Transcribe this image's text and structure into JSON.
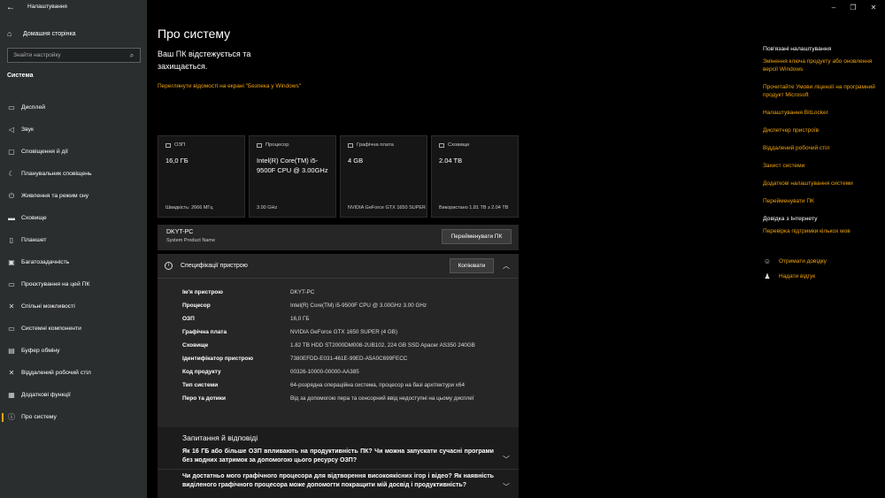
{
  "app": {
    "title": "Налаштування",
    "back_icon": "back-arrow-icon",
    "window_controls": [
      "–",
      "❐",
      "✕"
    ]
  },
  "sidebar": {
    "home_label": "Домашня сторінка",
    "search_placeholder": "Знайти настройку",
    "section_title": "Система",
    "items": [
      {
        "label": "Дисплей",
        "icon": "display-icon",
        "glyph": "▭"
      },
      {
        "label": "Звук",
        "icon": "sound-icon",
        "glyph": "◁"
      },
      {
        "label": "Сповіщення й дії",
        "icon": "notifications-icon",
        "glyph": "▢"
      },
      {
        "label": "Планувальник сповіщень",
        "icon": "focus-assist-icon",
        "glyph": "☾"
      },
      {
        "label": "Живлення та режим сну",
        "icon": "power-icon",
        "glyph": "⏻"
      },
      {
        "label": "Сховище",
        "icon": "storage-icon",
        "glyph": "▬"
      },
      {
        "label": "Планшет",
        "icon": "tablet-icon",
        "glyph": "▯"
      },
      {
        "label": "Багатозадачність",
        "icon": "multitasking-icon",
        "glyph": "▣"
      },
      {
        "label": "Проєктування на цей ПК",
        "icon": "projecting-icon",
        "glyph": "▭"
      },
      {
        "label": "Спільні можливості",
        "icon": "shared-experiences-icon",
        "glyph": "✕"
      },
      {
        "label": "Системні компоненти",
        "icon": "components-icon",
        "glyph": "▭"
      },
      {
        "label": "Буфер обміну",
        "icon": "clipboard-icon",
        "glyph": "▤"
      },
      {
        "label": "Віддалений робочий стіл",
        "icon": "remote-desktop-icon",
        "glyph": "✕"
      },
      {
        "label": "Додаткові функції",
        "icon": "optional-features-icon",
        "glyph": "▦"
      },
      {
        "label": "Про систему",
        "icon": "about-icon",
        "glyph": "ⓘ",
        "active": true
      }
    ]
  },
  "main": {
    "title": "Про систему",
    "protect_text": "Ваш ПК відстежується та захищається.",
    "security_link": "Переглянути відомості на екрані \"Безпека у Windows\"",
    "cards": [
      {
        "title": "ОЗП",
        "icon": "ram-icon",
        "value": "16,0 ГБ",
        "foot": "Швидкість: 2666 МГц"
      },
      {
        "title": "Процесор",
        "icon": "cpu-icon",
        "value": "Intel(R) Core(TM) i5-9500F CPU @ 3.00GHz",
        "foot": "3.00 GHz"
      },
      {
        "title": "Графічна плата",
        "icon": "gpu-icon",
        "value": "4 GB",
        "foot": "NVIDIA GeForce GTX 1650 SUPER"
      },
      {
        "title": "Сховище",
        "icon": "storage-card-icon",
        "value": "2.04 TB",
        "foot": "Використано 1.81 TB з 2.04 TB"
      }
    ],
    "pc_name": "DKYT-PC",
    "pc_model": "System Product Name",
    "rename_button": "Перейменувати ПК",
    "specs": {
      "title": "Специфікації пристрою",
      "copy_button": "Копіювати",
      "rows": [
        {
          "k": "Ім'я пристрою",
          "v": "DKYT-PC"
        },
        {
          "k": "Процесор",
          "v": "Intel(R) Core(TM) i5-9500F CPU @ 3.00GHz   3.00 GHz"
        },
        {
          "k": "ОЗП",
          "v": "16,0 ГБ"
        },
        {
          "k": "Графічна плата",
          "v": "NVIDIA GeForce GTX 1650 SUPER (4 GB)"
        },
        {
          "k": "Сховище",
          "v": "1.82 TB HDD ST2000DM008-2UB102, 224 GB SSD Apacer AS350 240GB"
        },
        {
          "k": "Ідентифікатор пристрою",
          "v": "7380EFDD-E031-461E-99ED-A5A0C699FECC"
        },
        {
          "k": "Код продукту",
          "v": "00326-10000-00000-AA385"
        },
        {
          "k": "Тип системи",
          "v": "64-розрядна операційна система, процесор на базі архітектури x64"
        },
        {
          "k": "Перо та дотики",
          "v": "Від за допомогою пера та сенсорний ввід недоступні на цьому дисплеї"
        }
      ]
    },
    "faq": {
      "title": "Запитання й відповіді",
      "q1": "Як 16 ГБ або більше ОЗП впливають на продуктивність ПК? Чи можна запускати сучасні програми без жодних затримок за допомогою цього ресурсу ОЗП?",
      "q2": "Чи достатньо мого графічного процесора для відтворення високоякісних ігор і відео? Як наявність виділеного графічного процесора може допомогти покращити мій досвід і продуктивність?"
    }
  },
  "right": {
    "related_title": "Пов'язані налаштування",
    "links": [
      "Змінення ключа продукту або оновлення версії Windows",
      "Прочитайте Умови ліцензії на програмний продукт Microsoft",
      "Налаштування BitLocker",
      "Диспетчер пристроїв",
      "Віддалений робочий стіл",
      "Захист системи",
      "Додаткові налаштування системи",
      "Перейменувати ПК"
    ],
    "help_title": "Довідка з Інтернету",
    "help_link": "Перевірка підтримки кількох мов",
    "get_help": "Отримати довідку",
    "feedback": "Надати відгук"
  }
}
